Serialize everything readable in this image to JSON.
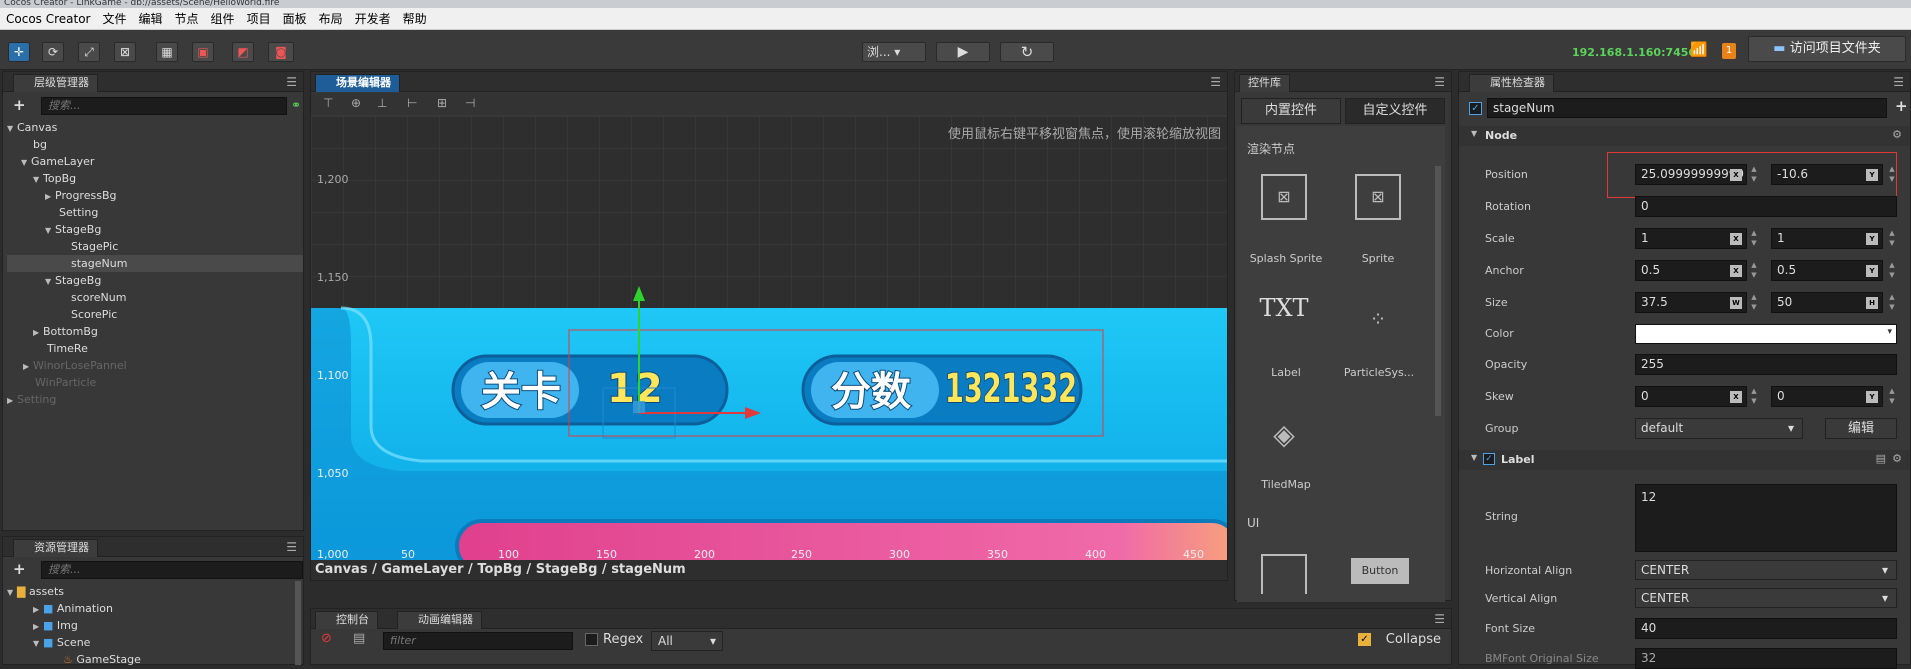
{
  "window": {
    "title": "Cocos Creator - LinkGame - db://assets/Scene/HelloWorld.fire"
  },
  "menubar": {
    "items": [
      "Cocos Creator",
      "文件",
      "编辑",
      "节点",
      "组件",
      "项目",
      "面板",
      "布局",
      "开发者",
      "帮助"
    ]
  },
  "toolbar": {
    "platform": "浏...",
    "ip": "192.168.1.160:7456",
    "notify_count": "1",
    "open_folder": "访问项目文件夹"
  },
  "hierarchy": {
    "tab": "层级管理器",
    "search_placeholder": "搜索...",
    "nodes": [
      "Canvas",
      "bg",
      "GameLayer",
      "TopBg",
      "ProgressBg",
      "Setting",
      "StageBg",
      "StagePic",
      "stageNum",
      "StageBg",
      "scoreNum",
      "ScorePic",
      "BottomBg",
      "TimeRe",
      "WinorLosePannel",
      "WinParticle",
      "Setting"
    ]
  },
  "assets": {
    "tab": "资源管理器",
    "search_placeholder": "搜索...",
    "items": [
      "assets",
      "Animation",
      "Img",
      "Scene",
      "GameStage"
    ]
  },
  "scene": {
    "tab": "场景编辑器",
    "hint": "使用鼠标右键平移视窗焦点，使用滚轮缩放视图",
    "y_labels": [
      "1,200",
      "1,150",
      "1,100",
      "1,050",
      "1,000"
    ],
    "x_labels": [
      "50",
      "100",
      "150",
      "200",
      "250",
      "300",
      "350",
      "400",
      "450"
    ],
    "stage_label": "关卡",
    "stage_num": "12",
    "score_label": "分数",
    "score_num": "1321332",
    "breadcrumb": "Canvas / GameLayer / TopBg / StageBg / stageNum"
  },
  "console": {
    "tab_console": "控制台",
    "tab_anim": "动画编辑器",
    "filter_placeholder": "filter",
    "regex": "Regex",
    "level": "All",
    "collapse": "Collapse"
  },
  "widgets": {
    "tab": "控件库",
    "tab_builtin": "内置控件",
    "tab_custom": "自定义控件",
    "section_render": "渲染节点",
    "section_ui": "UI",
    "items": [
      "Splash Sprite",
      "Sprite",
      "Label",
      "ParticleSys...",
      "TiledMap"
    ],
    "txt_glyph": "TXT",
    "button_label": "Button"
  },
  "inspector": {
    "tab": "属性检查器",
    "node_name": "stageNum",
    "node_section": "Node",
    "label_section": "Label",
    "props": {
      "position_label": "Position",
      "position_x": "25.09999999999",
      "position_y": "-10.6",
      "rotation_label": "Rotation",
      "rotation": "0",
      "scale_label": "Scale",
      "scale_x": "1",
      "scale_y": "1",
      "anchor_label": "Anchor",
      "anchor_x": "0.5",
      "anchor_y": "0.5",
      "size_label": "Size",
      "size_w": "37.5",
      "size_h": "50",
      "color_label": "Color",
      "opacity_label": "Opacity",
      "opacity": "255",
      "skew_label": "Skew",
      "skew_x": "0",
      "skew_y": "0",
      "group_label": "Group",
      "group": "default",
      "edit_btn": "编辑",
      "string_label": "String",
      "string": "12",
      "halign_label": "Horizontal Align",
      "halign": "CENTER",
      "valign_label": "Vertical Align",
      "valign": "CENTER",
      "fontsize_label": "Font Size",
      "fontsize": "40",
      "bmfont_label": "BMFont Original Size",
      "bmfont": "32"
    },
    "axis": {
      "x": "X",
      "y": "Y",
      "w": "W",
      "h": "H"
    }
  }
}
